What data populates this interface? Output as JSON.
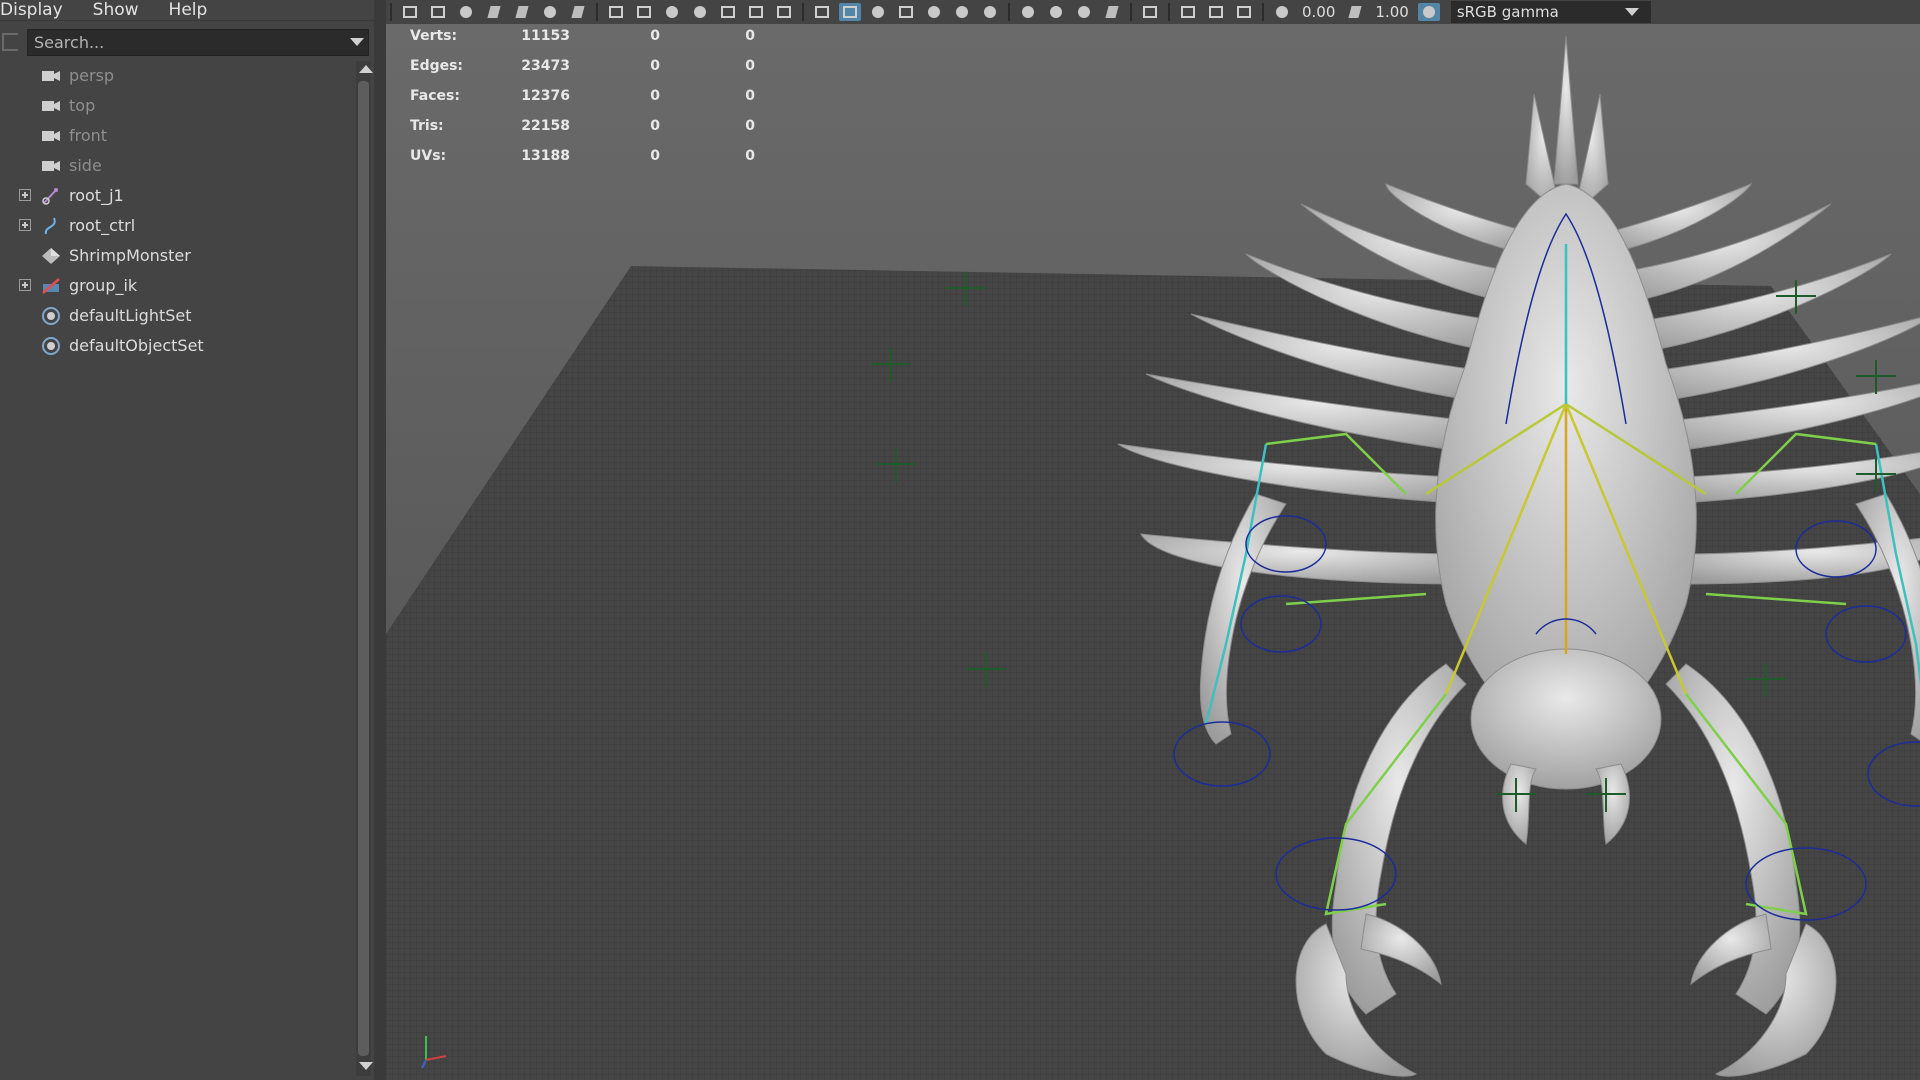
{
  "outliner": {
    "menu": [
      "Display",
      "Show",
      "Help"
    ],
    "search_placeholder": "Search...",
    "items": [
      {
        "label": "persp",
        "icon": "camera-icon",
        "expandable": false,
        "dim": true
      },
      {
        "label": "top",
        "icon": "camera-icon",
        "expandable": false,
        "dim": true
      },
      {
        "label": "front",
        "icon": "camera-icon",
        "expandable": false,
        "dim": true
      },
      {
        "label": "side",
        "icon": "camera-icon",
        "expandable": false,
        "dim": true
      },
      {
        "label": "root_j1",
        "icon": "joint-icon",
        "expandable": true,
        "dim": false
      },
      {
        "label": "root_ctrl",
        "icon": "curve-icon",
        "expandable": true,
        "dim": false
      },
      {
        "label": "ShrimpMonster",
        "icon": "mesh-icon",
        "expandable": false,
        "dim": false
      },
      {
        "label": "group_ik",
        "icon": "ik-group-icon",
        "expandable": true,
        "dim": false
      },
      {
        "label": "defaultLightSet",
        "icon": "set-icon",
        "expandable": false,
        "dim": false
      },
      {
        "label": "defaultObjectSet",
        "icon": "set-icon",
        "expandable": false,
        "dim": false
      }
    ]
  },
  "toolbar": {
    "exposure_value": "0.00",
    "gamma_value": "1.00",
    "color_space": "sRGB gamma",
    "accent_color": "#5285a6"
  },
  "hud": {
    "rows": [
      {
        "label": "Verts:",
        "v1": "11153",
        "v2": "0",
        "v3": "0"
      },
      {
        "label": "Edges:",
        "v1": "23473",
        "v2": "0",
        "v3": "0"
      },
      {
        "label": "Faces:",
        "v1": "12376",
        "v2": "0",
        "v3": "0"
      },
      {
        "label": "Tris:",
        "v1": "22158",
        "v2": "0",
        "v3": "0"
      },
      {
        "label": "UVs:",
        "v1": "13188",
        "v2": "0",
        "v3": "0"
      }
    ]
  }
}
